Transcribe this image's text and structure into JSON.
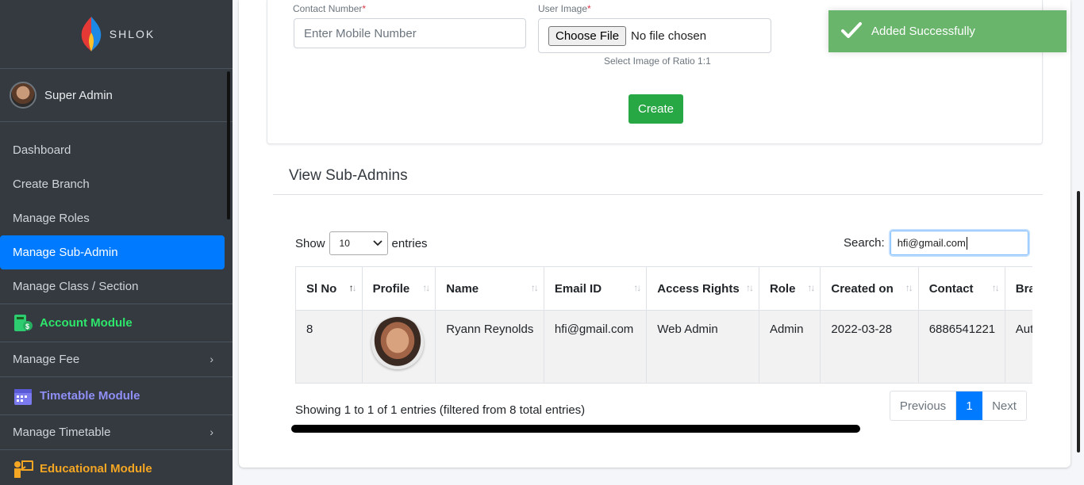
{
  "sidebar": {
    "brand": "SHLOK",
    "user_name": "Super Admin",
    "items": [
      {
        "label": "Dashboard"
      },
      {
        "label": "Create Branch"
      },
      {
        "label": "Manage Roles"
      },
      {
        "label": "Manage Sub-Admin"
      },
      {
        "label": "Manage Class / Section"
      }
    ],
    "modules": {
      "account": "Account Module",
      "manage_fee": "Manage Fee",
      "timetable": "Timetable Module",
      "manage_timetable": "Manage Timetable",
      "educational": "Educational Module"
    },
    "colors": {
      "active": "#007bff",
      "account": "#2ee66b",
      "timetable": "#8f8ff5",
      "educational": "#f5a623"
    }
  },
  "form": {
    "contact_label": "Contact Number",
    "contact_placeholder": "Enter Mobile Number",
    "image_label": "User Image",
    "choose_file": "Choose File",
    "no_file": "No file chosen",
    "image_hint": "Select Image of Ratio 1:1",
    "create_label": "Create",
    "required_mark": "*"
  },
  "list": {
    "title": "View Sub-Admins",
    "show_label": "Show",
    "entries_label": "entries",
    "page_size": "10",
    "search_label": "Search:",
    "search_value": "hfi@gmail.com",
    "columns": [
      "Sl No",
      "Profile",
      "Name",
      "Email ID",
      "Access Rights",
      "Role",
      "Created on",
      "Contact",
      "Branc"
    ],
    "rows": [
      {
        "sl": "8",
        "name": "Ryann Reynolds",
        "email": "hfi@gmail.com",
        "access": "Web Admin",
        "role": "Admin",
        "created": "2022-03-28",
        "contact": "6886541221",
        "branch": "Autor"
      }
    ],
    "info": "Showing 1 to 1 of 1 entries (filtered from 8 total entries)",
    "pager": {
      "prev": "Previous",
      "current": "1",
      "next": "Next"
    }
  },
  "toast": {
    "message": "Added Successfully",
    "color": "#6ab56c"
  }
}
